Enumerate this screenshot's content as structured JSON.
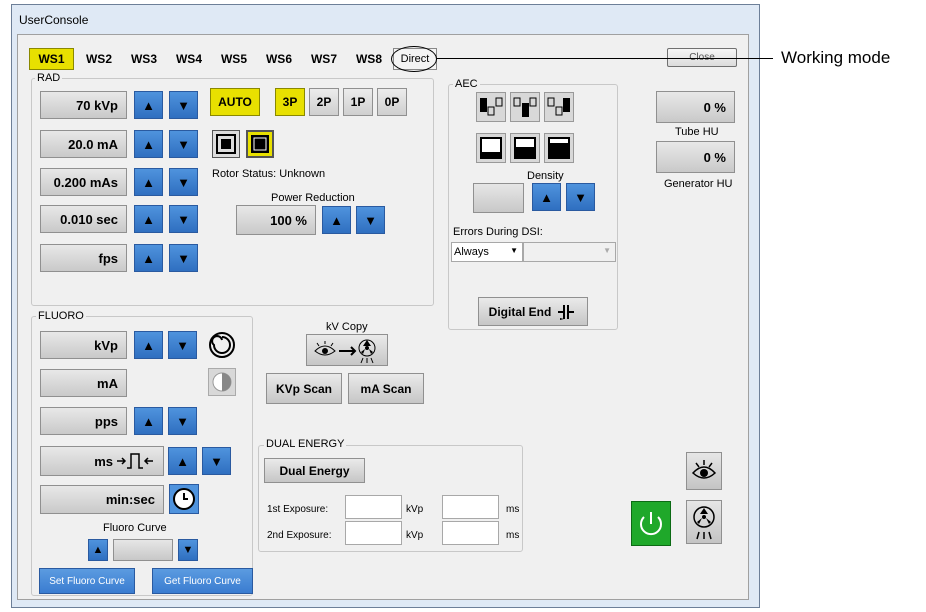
{
  "window": {
    "title": "UserConsole"
  },
  "tabs": [
    "WS1",
    "WS2",
    "WS3",
    "WS4",
    "WS5",
    "WS6",
    "WS7",
    "WS8"
  ],
  "direct_label": "Direct",
  "close_label": "Close",
  "annotation": "Working mode",
  "rad": {
    "title": "RAD",
    "kvp": "70  kVp",
    "ma": "20.0  mA",
    "mas": "0.200 mAs",
    "sec": "0.010  sec",
    "fps": "fps",
    "modes": [
      "AUTO",
      "3P",
      "2P",
      "1P",
      "0P"
    ],
    "rotor_status": "Rotor Status: Unknown",
    "power_reduction_label": "Power Reduction",
    "power_reduction_value": "100  %"
  },
  "aec": {
    "title": "AEC",
    "density_label": "Density",
    "errors_label": "Errors During DSI:",
    "errors_value": "Always",
    "digital_end": "Digital End"
  },
  "tube_hu": {
    "value": "0  %",
    "label": "Tube HU"
  },
  "generator_hu": {
    "value": "0  %",
    "label": "Generator HU"
  },
  "fluoro": {
    "title": "FLUORO",
    "kvp": "kVp",
    "ma": "mA",
    "pps": "pps",
    "ms": "ms",
    "minsec": "min:sec",
    "curve_label": "Fluoro Curve",
    "set_curve": "Set Fluoro Curve",
    "get_curve": "Get Fluoro Curve"
  },
  "kv_copy": {
    "label": "kV Copy",
    "kvp_scan": "KVp Scan",
    "ma_scan": "mA Scan"
  },
  "dual_energy": {
    "title": "DUAL ENERGY",
    "button": "Dual Energy",
    "first_label": "1st Exposure:",
    "second_label": "2nd Exposure:",
    "kvp_unit": "kVp",
    "ms_unit": "ms"
  },
  "colors": {
    "accent_yellow": "#e8e000",
    "arrow_blue": "#3a7cd0",
    "power_green": "#1fa82a"
  }
}
